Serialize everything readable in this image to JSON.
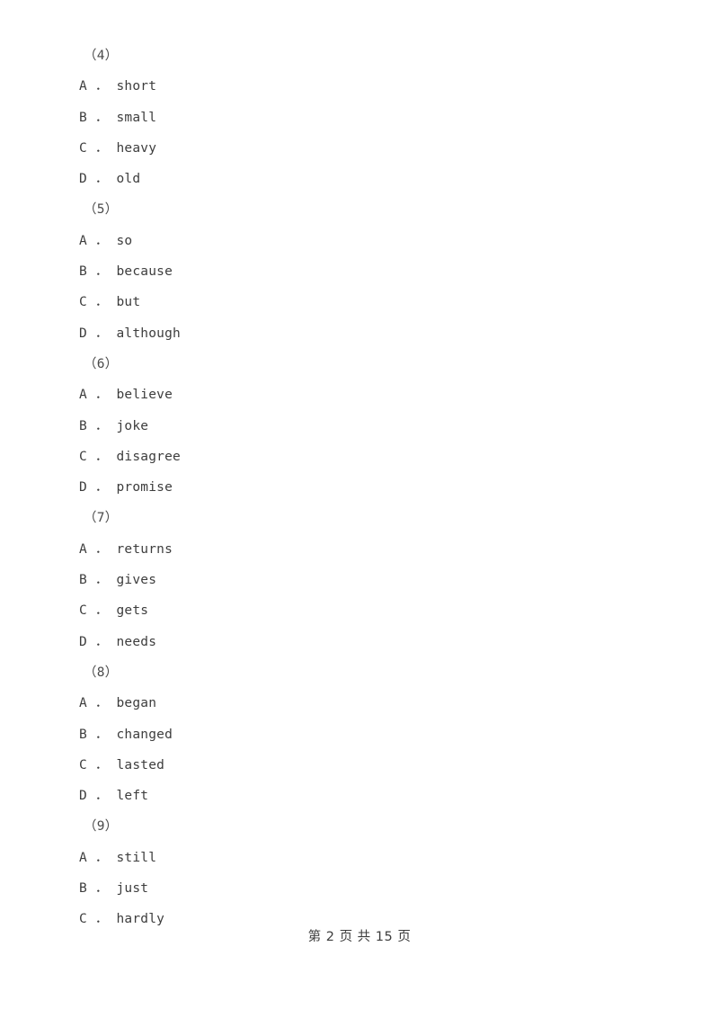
{
  "document": {
    "type": "exam-paper-page",
    "background_color": "#ffffff",
    "text_color": "#3d3d3d"
  },
  "body_lines": [
    {
      "kind": "qnum",
      "text": "（4）"
    },
    {
      "kind": "option",
      "text": "A ． short"
    },
    {
      "kind": "option",
      "text": "B ． small"
    },
    {
      "kind": "option",
      "text": "C ． heavy"
    },
    {
      "kind": "option",
      "text": "D ． old"
    },
    {
      "kind": "qnum",
      "text": "（5）"
    },
    {
      "kind": "option",
      "text": "A ． so"
    },
    {
      "kind": "option",
      "text": "B ． because"
    },
    {
      "kind": "option",
      "text": "C ． but"
    },
    {
      "kind": "option",
      "text": "D ． although"
    },
    {
      "kind": "qnum",
      "text": "（6）"
    },
    {
      "kind": "option",
      "text": "A ． believe"
    },
    {
      "kind": "option",
      "text": "B ． joke"
    },
    {
      "kind": "option",
      "text": "C ． disagree"
    },
    {
      "kind": "option",
      "text": "D ． promise"
    },
    {
      "kind": "qnum",
      "text": "（7）"
    },
    {
      "kind": "option",
      "text": "A ． returns"
    },
    {
      "kind": "option",
      "text": "B ． gives"
    },
    {
      "kind": "option",
      "text": "C ． gets"
    },
    {
      "kind": "option",
      "text": "D ． needs"
    },
    {
      "kind": "qnum",
      "text": "（8）"
    },
    {
      "kind": "option",
      "text": "A ． began"
    },
    {
      "kind": "option",
      "text": "B ． changed"
    },
    {
      "kind": "option",
      "text": "C ． lasted"
    },
    {
      "kind": "option",
      "text": "D ． left"
    },
    {
      "kind": "qnum",
      "text": "（9）"
    },
    {
      "kind": "option",
      "text": "A ． still"
    },
    {
      "kind": "option",
      "text": "B ． just"
    },
    {
      "kind": "option",
      "text": "C ． hardly"
    }
  ],
  "footer": {
    "text": "第 2 页 共 15 页",
    "current_page": "2",
    "total_pages": "15"
  }
}
